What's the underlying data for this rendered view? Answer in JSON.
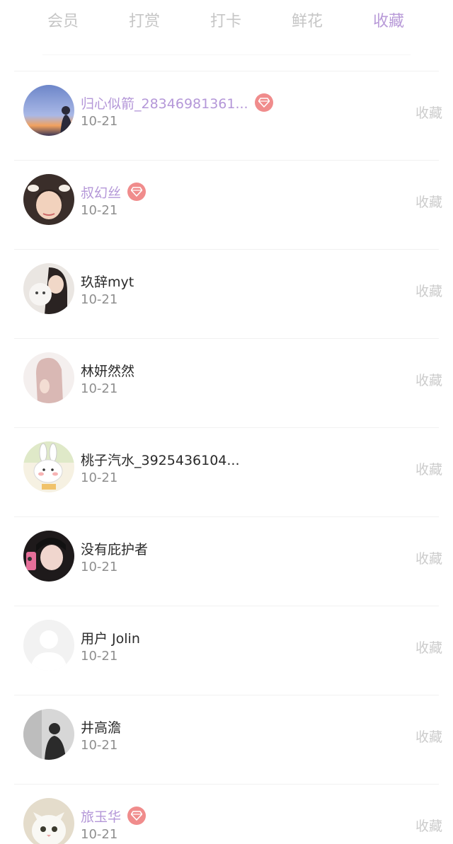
{
  "tabs": [
    {
      "label": "会员",
      "active": false
    },
    {
      "label": "打赏",
      "active": false
    },
    {
      "label": "打卡",
      "active": false
    },
    {
      "label": "鲜花",
      "active": false
    },
    {
      "label": "收藏",
      "active": true
    }
  ],
  "colors": {
    "accent": "#b89ad8",
    "vip_name": "#b497d8",
    "badge": "#f08c8c",
    "muted": "#cccccc"
  },
  "list": [
    {
      "name": "归心似箭_28346981361...",
      "date": "10-21",
      "action": "收藏",
      "vip": true,
      "avatar": "sunset-silhouette"
    },
    {
      "name": "叔幻丝",
      "date": "10-21",
      "action": "收藏",
      "vip": true,
      "avatar": "boy-with-puppy-ears"
    },
    {
      "name": "玖辞myt",
      "date": "10-21",
      "action": "收藏",
      "vip": false,
      "avatar": "girl-with-cat"
    },
    {
      "name": "林妍然然",
      "date": "10-21",
      "action": "收藏",
      "vip": false,
      "avatar": "pink-hair-girl"
    },
    {
      "name": "桃子汽水_3925436104...",
      "date": "10-21",
      "action": "收藏",
      "vip": false,
      "avatar": "cartoon-bunny"
    },
    {
      "name": "没有庇护者",
      "date": "10-21",
      "action": "收藏",
      "vip": false,
      "avatar": "selfie-girl"
    },
    {
      "name": "用户 Jolin",
      "date": "10-21",
      "action": "收藏",
      "vip": false,
      "avatar": "default-user"
    },
    {
      "name": "井高澹",
      "date": "10-21",
      "action": "收藏",
      "vip": false,
      "avatar": "grey-silhouette"
    },
    {
      "name": "旅玉华",
      "date": "10-21",
      "action": "收藏",
      "vip": true,
      "avatar": "white-cat"
    }
  ]
}
